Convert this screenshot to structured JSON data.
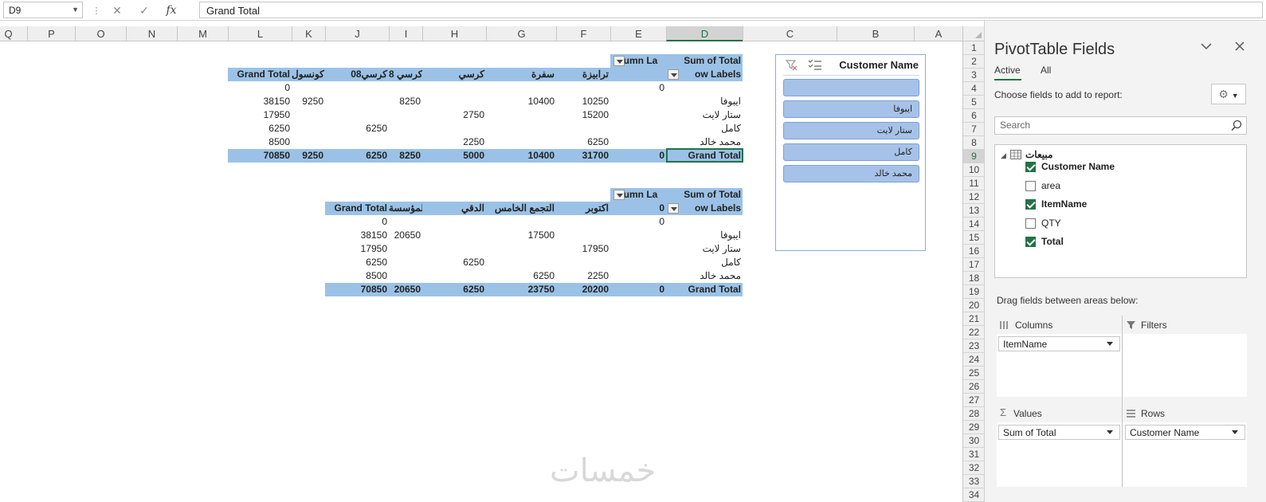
{
  "formula_bar": {
    "name_box": "D9",
    "cancel_glyph": "✕",
    "enter_glyph": "✓",
    "fx_glyph": "fx",
    "formula": "Grand Total"
  },
  "columns": [
    "Q",
    "P",
    "O",
    "N",
    "M",
    "L",
    "K",
    "J",
    "I",
    "H",
    "G",
    "F",
    "E",
    "D",
    "C",
    "B",
    "A"
  ],
  "rows": [
    "1",
    "2",
    "3",
    "4",
    "5",
    "6",
    "7",
    "8",
    "9",
    "10",
    "11",
    "12",
    "13",
    "14",
    "15",
    "16",
    "17",
    "18",
    "19",
    "20",
    "21",
    "22",
    "23",
    "24",
    "25",
    "26",
    "27",
    "28",
    "29",
    "30",
    "31",
    "32",
    "33",
    "34"
  ],
  "pivot1": {
    "header_values": "Sum of Total",
    "header_columns": "olumn La",
    "header_rows": "ow Labels",
    "col_labels": [
      "ترابيزة",
      "سفرة",
      "كرسي",
      "كرسي 8",
      "كرسي08",
      "كونسول",
      "Grand Total"
    ],
    "rows": [
      {
        "label": "",
        "vals": [
          "0",
          "",
          "",
          "",
          "",
          "",
          "",
          "0"
        ]
      },
      {
        "label": "ايبوفا",
        "vals": [
          "",
          "10250",
          "10400",
          "",
          "8250",
          "",
          "9250",
          "38150"
        ]
      },
      {
        "label": "ستار لايت",
        "vals": [
          "",
          "15200",
          "",
          "2750",
          "",
          "",
          "",
          "17950"
        ]
      },
      {
        "label": "كامل",
        "vals": [
          "",
          "",
          "",
          "",
          "",
          "6250",
          "",
          "6250"
        ]
      },
      {
        "label": "محمد خالد",
        "vals": [
          "",
          "6250",
          "",
          "2250",
          "",
          "",
          "",
          "8500"
        ]
      }
    ],
    "total": {
      "label": "Grand Total",
      "vals": [
        "0",
        "31700",
        "10400",
        "5000",
        "8250",
        "6250",
        "9250",
        "70850"
      ]
    }
  },
  "pivot2": {
    "header_values": "Sum of Total",
    "header_columns": "olumn La",
    "header_rows": "ow Labels",
    "col_labels": [
      "0",
      "اكتوبر",
      "التجمع الخامس",
      "الدقي",
      "المؤسسة",
      "Grand Total"
    ],
    "rows": [
      {
        "label": "",
        "vals": [
          "0",
          "",
          "",
          "",
          "",
          "0"
        ]
      },
      {
        "label": "ايبوفا",
        "vals": [
          "",
          "",
          "17500",
          "",
          "20650",
          "38150"
        ]
      },
      {
        "label": "ستار لايت",
        "vals": [
          "",
          "17950",
          "",
          "",
          "",
          "17950"
        ]
      },
      {
        "label": "كامل",
        "vals": [
          "",
          "",
          "",
          "6250",
          "",
          "6250"
        ]
      },
      {
        "label": "محمد خالد",
        "vals": [
          "",
          "2250",
          "6250",
          "",
          "",
          "8500"
        ]
      }
    ],
    "total": {
      "label": "Grand Total",
      "vals": [
        "0",
        "20200",
        "23750",
        "6250",
        "20650",
        "70850"
      ]
    }
  },
  "slicer": {
    "title": "Customer Name",
    "items": [
      "",
      "ايبوفا",
      "ستار لايت",
      "كامل",
      "محمد خالد"
    ]
  },
  "pane": {
    "title": "PivotTable Fields",
    "tabs": [
      "Active",
      "All"
    ],
    "choose": "Choose fields to add to report:",
    "search_placeholder": "Search",
    "table_name": "مبيعات",
    "fields": [
      {
        "name": "Customer Name",
        "checked": true
      },
      {
        "name": "area",
        "checked": false
      },
      {
        "name": "ItemName",
        "checked": true
      },
      {
        "name": "QTY",
        "checked": false
      },
      {
        "name": "Total",
        "checked": true
      }
    ],
    "drag_hint": "Drag fields between areas below:",
    "areas": {
      "columns": {
        "label": "Columns",
        "items": [
          "ItemName"
        ]
      },
      "filters": {
        "label": "Filters",
        "items": []
      },
      "values": {
        "label": "Values",
        "items": [
          "Sum of Total"
        ]
      },
      "rows": {
        "label": "Rows",
        "items": [
          "Customer Name"
        ]
      }
    }
  },
  "watermark": "خمسات"
}
